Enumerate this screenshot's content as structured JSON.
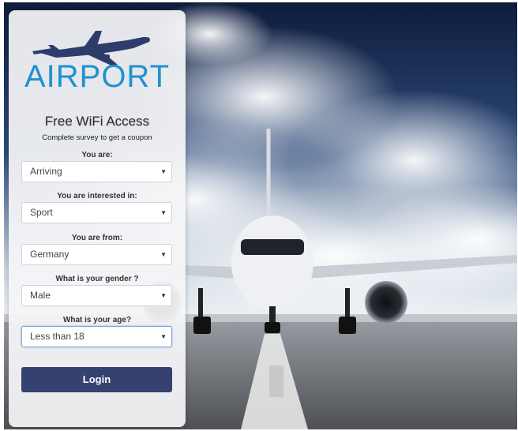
{
  "logo": {
    "text": "AIRPORT",
    "brand_color": "#1f93d0",
    "plane_color": "#2e3c6b"
  },
  "header": {
    "title": "Free WiFi Access",
    "subtitle": "Complete survey to get a coupon"
  },
  "form": {
    "fields": [
      {
        "label": "You are:",
        "value": "Arriving"
      },
      {
        "label": "You are interested in:",
        "value": "Sport"
      },
      {
        "label": "You are from:",
        "value": "Germany"
      },
      {
        "label": "What is your gender ?",
        "value": "Male"
      },
      {
        "label": "What is your age?",
        "value": "Less than 18"
      }
    ],
    "login_label": "Login"
  },
  "icons": {
    "dropdown": "chevron-down-icon"
  },
  "colors": {
    "button": "#35416f",
    "sky_dark": "#0f1c3c"
  }
}
